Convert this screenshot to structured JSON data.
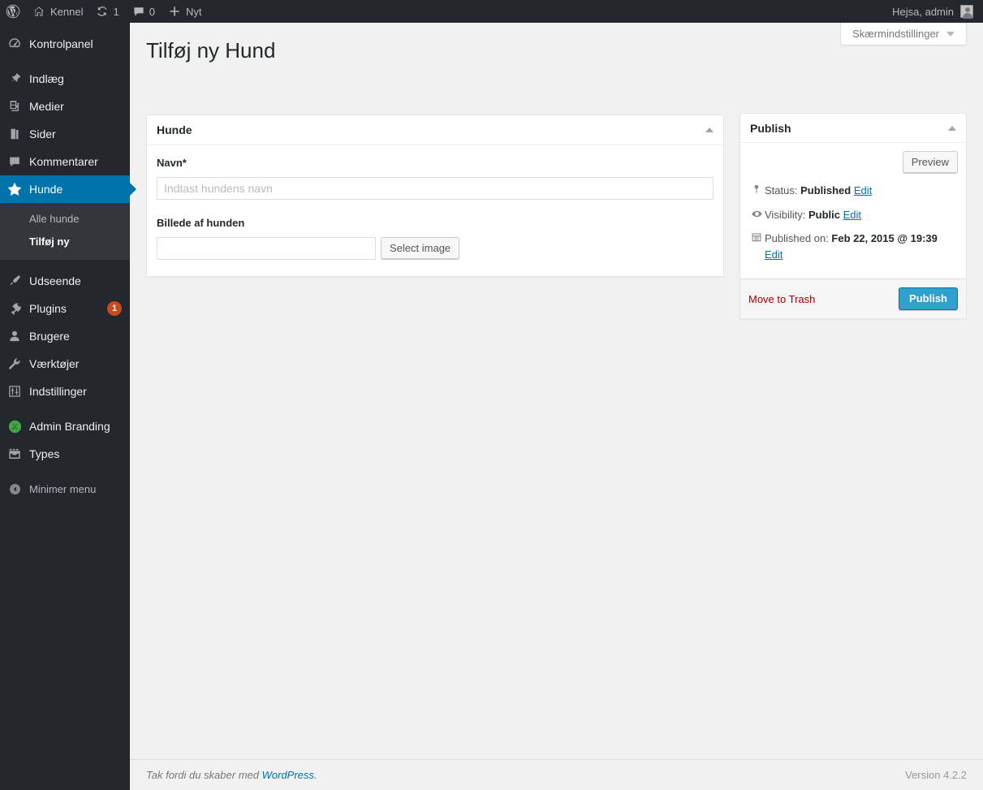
{
  "adminbar": {
    "wp_logo": "wordpress-logo",
    "site_name": "Kennel",
    "updates_count": "1",
    "comments_count": "0",
    "new_label": "Nyt",
    "howdy": "Hejsa, admin"
  },
  "screen_options": {
    "label": "Skærmindstillinger"
  },
  "sidebar": {
    "groups": [
      {
        "items": [
          {
            "label": "Kontrolpanel",
            "icon": "dashboard-icon",
            "name": "dashboard"
          }
        ]
      },
      {
        "items": [
          {
            "label": "Indlæg",
            "icon": "pin-icon",
            "name": "posts"
          },
          {
            "label": "Medier",
            "icon": "media-icon",
            "name": "media"
          },
          {
            "label": "Sider",
            "icon": "pages-icon",
            "name": "pages"
          },
          {
            "label": "Kommentarer",
            "icon": "comment-icon",
            "name": "comments"
          },
          {
            "label": "Hunde",
            "icon": "star-icon",
            "name": "hunde",
            "current": true
          }
        ]
      },
      {
        "items": [
          {
            "label": "Udseende",
            "icon": "brush-icon",
            "name": "appearance"
          },
          {
            "label": "Plugins",
            "icon": "plug-icon",
            "name": "plugins",
            "badge": "1"
          },
          {
            "label": "Brugere",
            "icon": "user-icon",
            "name": "users"
          },
          {
            "label": "Værktøjer",
            "icon": "wrench-icon",
            "name": "tools"
          },
          {
            "label": "Indstillinger",
            "icon": "settings-icon",
            "name": "settings"
          }
        ]
      },
      {
        "items": [
          {
            "label": "Admin Branding",
            "icon": "branding-icon",
            "name": "admin-branding"
          },
          {
            "label": "Types",
            "icon": "types-icon",
            "name": "types"
          }
        ]
      }
    ],
    "submenu": {
      "parent": "hunde",
      "items": [
        {
          "label": "Alle hunde",
          "name": "alle-hunde"
        },
        {
          "label": "Tilføj ny",
          "name": "tilfoej-ny",
          "current": true
        }
      ]
    },
    "collapse": {
      "label": "Minimer menu",
      "icon": "collapse-icon"
    }
  },
  "page": {
    "title": "Tilføj ny Hund"
  },
  "metabox": {
    "title": "Hunde",
    "name_label": "Navn*",
    "name_value": "",
    "name_placeholder": "Indtast hundens navn",
    "image_label": "Billede af hunden",
    "image_value": "",
    "select_image_label": "Select image"
  },
  "publish": {
    "title": "Publish",
    "preview_label": "Preview",
    "status_label": "Status:",
    "status_value": "Published",
    "status_edit": "Edit",
    "visibility_label": "Visibility:",
    "visibility_value": "Public",
    "visibility_edit": "Edit",
    "published_label": "Published on:",
    "published_value": "Feb 22, 2015 @ 19:39",
    "published_edit": "Edit",
    "trash_label": "Move to Trash",
    "publish_label": "Publish"
  },
  "footer": {
    "thanks_prefix": "Tak fordi du skaber med ",
    "wordpress_link": "WordPress.",
    "version": "Version 4.2.2"
  },
  "colors": {
    "admin_bar": "#23282d",
    "sidebar": "#23282d",
    "accent": "#0073aa",
    "button_primary": "#2ea2cc",
    "badge": "#ca4a1f",
    "trash": "#a00",
    "background": "#f1f1f1"
  }
}
